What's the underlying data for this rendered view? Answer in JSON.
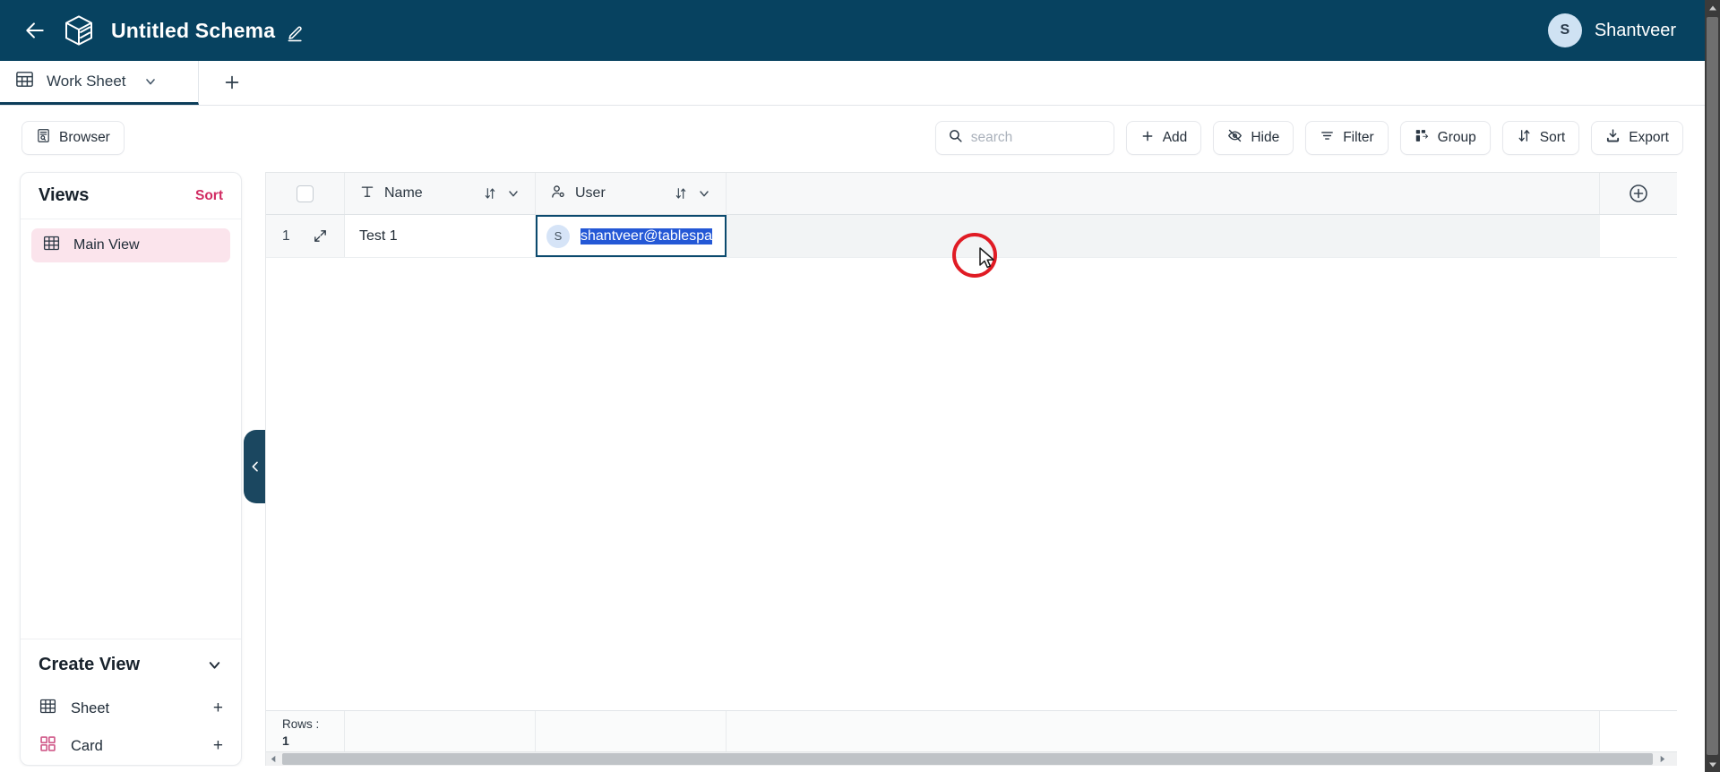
{
  "header": {
    "back_icon": "back-arrow-icon",
    "logo_icon": "cube-logo-icon",
    "title": "Untitled Schema",
    "edit_icon": "pencil-icon",
    "user": {
      "initial": "S",
      "name": "Shantveer"
    },
    "bg_color": "#074260"
  },
  "tabs": {
    "sheet_icon": "table-icon",
    "active_tab": "Work Sheet",
    "caret_icon": "chevron-down-icon",
    "add_tab_icon": "plus-icon"
  },
  "toolbar": {
    "browser_label": "Browser",
    "browser_icon": "browser-icon",
    "search": {
      "placeholder": "search",
      "value": "",
      "icon": "search-icon"
    },
    "buttons": [
      {
        "label": "Add",
        "icon": "plus-icon"
      },
      {
        "label": "Hide",
        "icon": "eye-off-icon"
      },
      {
        "label": "Filter",
        "icon": "filter-icon"
      },
      {
        "label": "Group",
        "icon": "group-icon"
      },
      {
        "label": "Sort",
        "icon": "sort-icon"
      },
      {
        "label": "Export",
        "icon": "download-icon"
      }
    ]
  },
  "views_panel": {
    "title": "Views",
    "sort_label": "Sort",
    "sort_color": "#d12b62",
    "items": [
      {
        "label": "Main View",
        "icon": "grid-icon",
        "selected": true,
        "selected_bg": "#fbe4ec"
      }
    ],
    "create_view": {
      "title": "Create View",
      "caret_icon": "chevron-down-icon",
      "options": [
        {
          "label": "Sheet",
          "icon": "grid-icon",
          "add_icon": "plus-icon"
        },
        {
          "label": "Card",
          "icon": "card-grid-icon",
          "add_icon": "plus-icon"
        }
      ]
    },
    "collapse_icon": "chevron-left-icon"
  },
  "grid": {
    "columns": [
      {
        "label": "Name",
        "type_icon": "text-type-icon",
        "sort_icon": "sort-updown-icon",
        "menu_icon": "chevron-down-icon"
      },
      {
        "label": "User",
        "type_icon": "user-type-icon",
        "sort_icon": "sort-updown-icon",
        "menu_icon": "chevron-down-icon"
      }
    ],
    "add_column_icon": "plus-circle-icon",
    "header_checkbox_checked": false,
    "rows": [
      {
        "number": "1",
        "expand_icon": "expand-diagonal-icon",
        "name": "Test 1",
        "user": {
          "initial": "S",
          "text": "shantveer@tablespa",
          "selected": true,
          "selection_color": "#2458d6"
        }
      }
    ],
    "footer": {
      "rows_label": "Rows :",
      "rows_count": "1"
    }
  },
  "annotations": {
    "click_circle_color": "#e01b24",
    "cursor_icon": "mouse-pointer-icon"
  }
}
